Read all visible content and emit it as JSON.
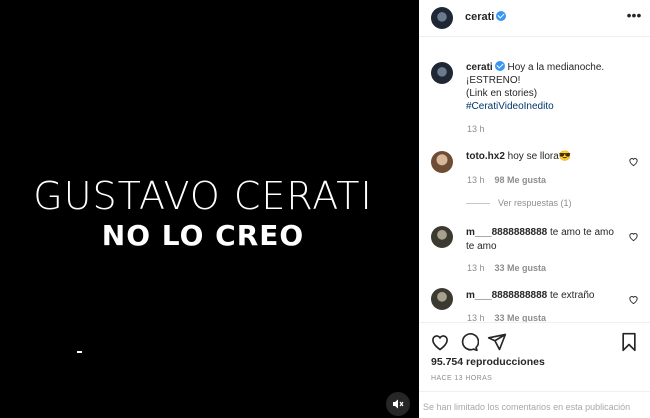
{
  "media": {
    "title": "GUSTAVO CERATI",
    "subtitle": "NO LO CREO",
    "mute_icon": "speaker-muted-icon"
  },
  "header": {
    "username": "cerati",
    "verified": true,
    "more_icon": "more-horizontal-icon"
  },
  "caption": {
    "username": "cerati",
    "line1": "Hoy a la medianoche.",
    "line2": "¡ESTRENO!",
    "line3": "(Link en stories)",
    "hashtag": "#CeratiVideoInedito",
    "time": "13 h"
  },
  "comments": [
    {
      "username": "toto.hx2",
      "text": "hoy se llora😎",
      "time": "13 h",
      "likes": "98 Me gusta",
      "replies": "Ver respuestas (1)"
    },
    {
      "username": "m___8888888888",
      "text": "te amo te amo te amo",
      "time": "13 h",
      "likes": "33 Me gusta"
    },
    {
      "username": "m___8888888888",
      "text": "te extraño",
      "time": "13 h",
      "likes": "33 Me gusta"
    }
  ],
  "actions": {
    "icons": [
      "heart-icon",
      "comment-icon",
      "share-icon",
      "bookmark-icon"
    ],
    "views": "95.754 reproducciones",
    "posted": "HACE 13 HORAS",
    "comments_limited": "Se han limitado los comentarios en esta publicación"
  },
  "colors": {
    "verified": "#3897f0",
    "hashtag": "#00376b",
    "muted_text": "#8e8e8e"
  }
}
